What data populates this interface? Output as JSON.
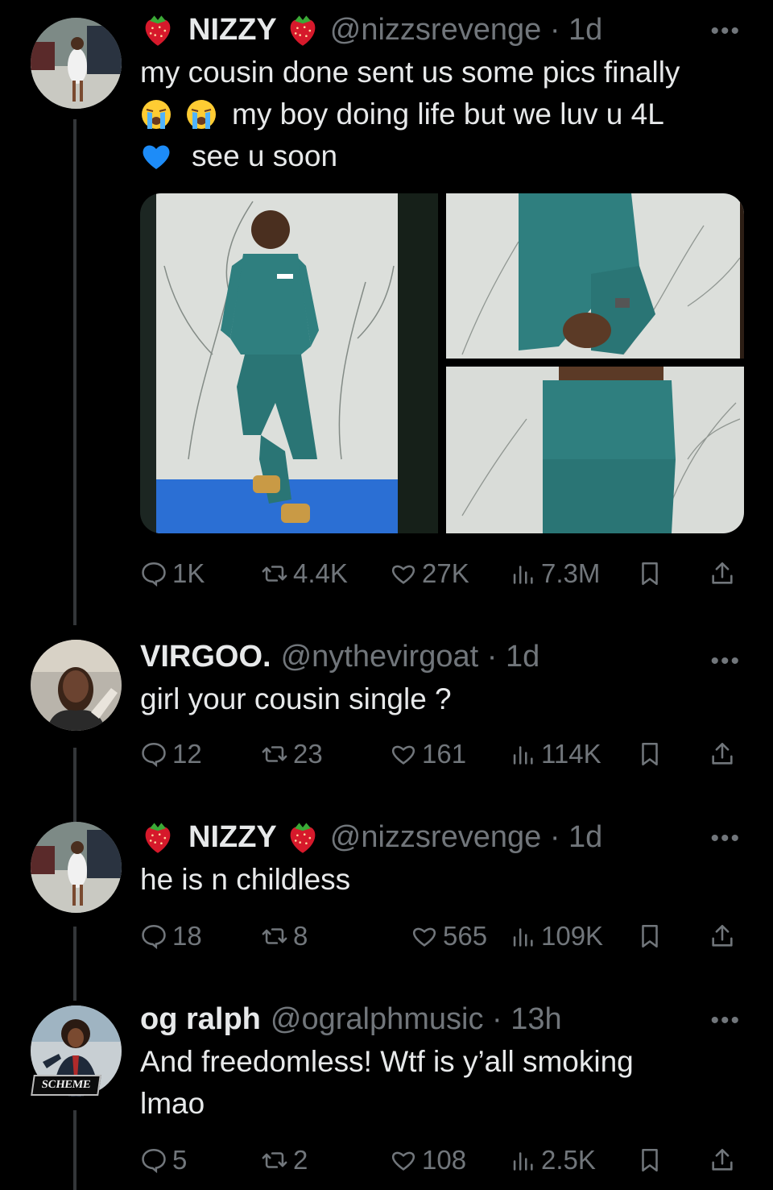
{
  "posts": [
    {
      "name": "NIZZY",
      "handle": "@nizzsrevenge · 1d",
      "text_line1": "my cousin done sent us some pics finally",
      "text_line2": "my boy doing life but we luv u 4L",
      "text_line3": "see u soon",
      "stats": {
        "replies": "1K",
        "reposts": "4.4K",
        "likes": "27K",
        "views": "7.3M"
      }
    },
    {
      "name": "VIRGOO.",
      "handle": "@nythevirgoat · 1d",
      "text": "girl your cousin single ?",
      "stats": {
        "replies": "12",
        "reposts": "23",
        "likes": "161",
        "views": "114K"
      }
    },
    {
      "name": "NIZZY",
      "handle": "@nizzsrevenge · 1d",
      "text": "he is n childless",
      "stats": {
        "replies": "18",
        "reposts": "8",
        "likes": "565",
        "views": "109K"
      }
    },
    {
      "name": "og ralph",
      "handle": "@ogralphmusic · 13h",
      "text_line1": "And freedomless! Wtf is y’all smoking",
      "text_line2": "lmao",
      "stats": {
        "replies": "5",
        "reposts": "2",
        "likes": "108",
        "views": "2.5K"
      }
    }
  ],
  "avatar_badge": "SCHEME",
  "colors": {
    "background": "#000000",
    "text": "#e7e9ea",
    "muted": "#71767b",
    "line": "#333639",
    "scrubs": "#2f7f7f",
    "backdrop": "#d9dcd8",
    "floor": "#2d6fd6"
  },
  "icons": [
    "strawberry-icon",
    "crying-face-icon",
    "blue-heart-icon",
    "reply-icon",
    "repost-icon",
    "like-icon",
    "views-icon",
    "bookmark-icon",
    "share-icon",
    "more-icon"
  ]
}
